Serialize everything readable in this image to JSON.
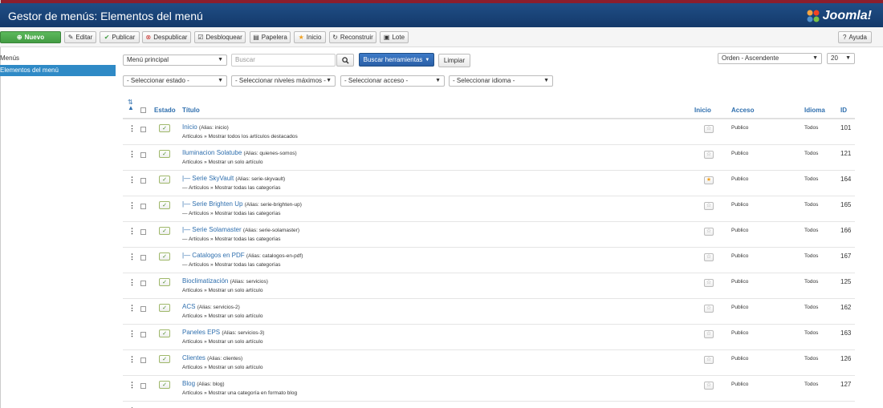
{
  "header": {
    "title": "Gestor de menús: Elementos del menú",
    "logo_text": "Joomla!"
  },
  "toolbar": {
    "new_label": "Nuevo",
    "edit_label": "Editar",
    "publish_label": "Publicar",
    "unpublish_label": "Despublicar",
    "unlock_label": "Desbloquear",
    "trash_label": "Papelera",
    "home_label": "Inicio",
    "rebuild_label": "Reconstruir",
    "batch_label": "Lote",
    "help_label": "Ayuda"
  },
  "sidebar": {
    "items": [
      {
        "label": "Menús"
      },
      {
        "label": "Elementos del menú"
      }
    ]
  },
  "filters": {
    "menu_select": "Menú principal",
    "search_placeholder": "Buscar",
    "search_tools_label": "Buscar herramientas",
    "clear_label": "Limpiar",
    "order_select": "Orden - Ascendente",
    "limit_select": "20",
    "state_select": "- Seleccionar estado -",
    "level_select": "- Seleccionar niveles máximos -",
    "access_select": "- Seleccionar acceso -",
    "language_select": "- Seleccionar idioma -"
  },
  "table": {
    "headers": {
      "status": "Estado",
      "title": "Título",
      "home": "Inicio",
      "access": "Acceso",
      "language": "Idioma",
      "id": "ID"
    },
    "rows": [
      {
        "title": "Inicio",
        "alias": "(Alias: inicio)",
        "sub": "Artículos » Mostrar todos los artículos destacados",
        "access": "Publico",
        "language": "Todos",
        "id": "101",
        "home": false
      },
      {
        "title": "Iluminacion Solatube",
        "alias": "(Alias: quienes-somos)",
        "sub": "Artículos » Mostrar un solo artículo",
        "access": "Publico",
        "language": "Todos",
        "id": "121",
        "home": false
      },
      {
        "title": "|— Serie SkyVault",
        "alias": "(Alias: serie-skyvault)",
        "sub": "— Artículos » Mostrar todas las categorías",
        "access": "Publico",
        "language": "Todos",
        "id": "164",
        "home": true
      },
      {
        "title": "|— Serie Brighten Up",
        "alias": "(Alias: serie-brighten-up)",
        "sub": "— Artículos » Mostrar todas las categorías",
        "access": "Publico",
        "language": "Todos",
        "id": "165",
        "home": false
      },
      {
        "title": "|— Serie Solamaster",
        "alias": "(Alias: serie-solamaster)",
        "sub": "— Artículos » Mostrar todas las categorías",
        "access": "Publico",
        "language": "Todos",
        "id": "166",
        "home": false
      },
      {
        "title": "|— Catalogos en PDF",
        "alias": "(Alias: catalogos-en-pdf)",
        "sub": "— Artículos » Mostrar todas las categorías",
        "access": "Publico",
        "language": "Todos",
        "id": "167",
        "home": false
      },
      {
        "title": "Bioclimatización",
        "alias": "(Alias: servicios)",
        "sub": "Artículos » Mostrar un solo artículo",
        "access": "Publico",
        "language": "Todos",
        "id": "125",
        "home": false
      },
      {
        "title": "ACS",
        "alias": "(Alias: servicios-2)",
        "sub": "Artículos » Mostrar un solo artículo",
        "access": "Publico",
        "language": "Todos",
        "id": "162",
        "home": false
      },
      {
        "title": "Paneles EPS",
        "alias": "(Alias: servicios-3)",
        "sub": "Artículos » Mostrar un solo artículo",
        "access": "Publico",
        "language": "Todos",
        "id": "163",
        "home": false
      },
      {
        "title": "Clientes",
        "alias": "(Alias: clientes)",
        "sub": "Artículos » Mostrar un solo artículo",
        "access": "Publico",
        "language": "Todos",
        "id": "126",
        "home": false
      },
      {
        "title": "Blog",
        "alias": "(Alias: blog)",
        "sub": "Artículos » Mostrar una categoría en formato blog",
        "access": "Publico",
        "language": "Todos",
        "id": "127",
        "home": false
      }
    ]
  }
}
